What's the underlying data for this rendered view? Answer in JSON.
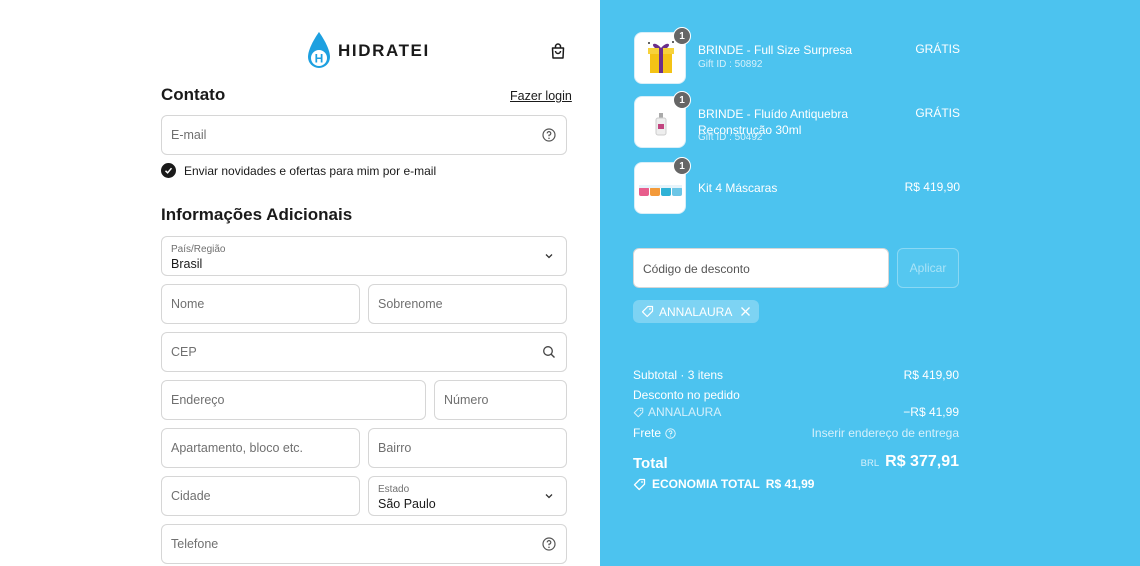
{
  "brand": {
    "name": "HIDRATEI",
    "logo_letter": "H",
    "color": "#1da0e0"
  },
  "contact": {
    "heading": "Contato",
    "login_link": "Fazer login",
    "email_placeholder": "E-mail",
    "newsletter_label": "Enviar novidades e ofertas para mim por e-mail",
    "newsletter_checked": true
  },
  "additional": {
    "heading": "Informações Adicionais",
    "country_label": "País/Região",
    "country_value": "Brasil",
    "first_name": "Nome",
    "last_name": "Sobrenome",
    "cep": "CEP",
    "address": "Endereço",
    "number": "Número",
    "apartment": "Apartamento, bloco etc.",
    "neighborhood": "Bairro",
    "city": "Cidade",
    "state_label": "Estado",
    "state_value": "São Paulo",
    "phone": "Telefone"
  },
  "cart": {
    "items": [
      {
        "name": "BRINDE - Full Size Surpresa",
        "sub": "Gift ID : 50892",
        "price": "GRÁTIS",
        "qty": "1"
      },
      {
        "name": "BRINDE - Fluído Antiquebra Reconstrução 30ml",
        "sub": "Gift ID : 50492",
        "price": "GRÁTIS",
        "qty": "1"
      },
      {
        "name": "Kit 4 Máscaras",
        "sub": "",
        "price": "R$ 419,90",
        "qty": "1"
      }
    ],
    "discount_placeholder": "Código de desconto",
    "apply_label": "Aplicar",
    "coupon_code": "ANNALAURA"
  },
  "summary": {
    "subtotal_label": "Subtotal · 3 itens",
    "subtotal_value": "R$ 419,90",
    "discount_label": "Desconto no pedido",
    "discount_code": "ANNALAURA",
    "discount_value": "−R$ 41,99",
    "shipping_label": "Frete",
    "shipping_value": "Inserir endereço de entrega",
    "total_label": "Total",
    "total_currency": "BRL",
    "total_value": "R$ 377,91",
    "savings_label": "ECONOMIA TOTAL",
    "savings_value": "R$ 41,99"
  }
}
